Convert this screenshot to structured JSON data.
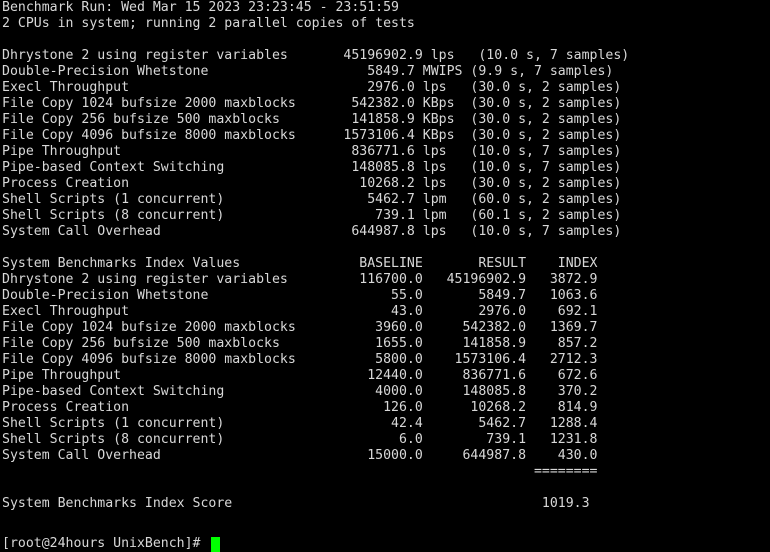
{
  "header": {
    "run": "Benchmark Run: Wed Mar 15 2023 23:23:45 - 23:51:59",
    "cpus": "2 CPUs in system; running 2 parallel copies of tests"
  },
  "results": [
    "Dhrystone 2 using register variables       45196902.9 lps   (10.0 s, 7 samples)",
    "Double-Precision Whetstone                    5849.7 MWIPS (9.9 s, 7 samples)",
    "Execl Throughput                              2976.0 lps   (30.0 s, 2 samples)",
    "File Copy 1024 bufsize 2000 maxblocks       542382.0 KBps  (30.0 s, 2 samples)",
    "File Copy 256 bufsize 500 maxblocks         141858.9 KBps  (30.0 s, 2 samples)",
    "File Copy 4096 bufsize 8000 maxblocks      1573106.4 KBps  (30.0 s, 2 samples)",
    "Pipe Throughput                             836771.6 lps   (10.0 s, 7 samples)",
    "Pipe-based Context Switching                148085.8 lps   (10.0 s, 7 samples)",
    "Process Creation                             10268.2 lps   (30.0 s, 2 samples)",
    "Shell Scripts (1 concurrent)                  5462.7 lpm   (60.0 s, 2 samples)",
    "Shell Scripts (8 concurrent)                   739.1 lpm   (60.1 s, 2 samples)",
    "System Call Overhead                        644987.8 lps   (10.0 s, 7 samples)"
  ],
  "index_header": "System Benchmarks Index Values               BASELINE       RESULT    INDEX",
  "index_rows": [
    "Dhrystone 2 using register variables         116700.0   45196902.9   3872.9",
    "Double-Precision Whetstone                       55.0       5849.7   1063.6",
    "Execl Throughput                                 43.0       2976.0    692.1",
    "File Copy 1024 bufsize 2000 maxblocks          3960.0     542382.0   1369.7",
    "File Copy 256 bufsize 500 maxblocks            1655.0     141858.9    857.2",
    "File Copy 4096 bufsize 8000 maxblocks          5800.0    1573106.4   2712.3",
    "Pipe Throughput                               12440.0     836771.6    672.6",
    "Pipe-based Context Switching                   4000.0     148085.8    370.2",
    "Process Creation                                126.0      10268.2    814.9",
    "Shell Scripts (1 concurrent)                     42.4       5462.7   1288.4",
    "Shell Scripts (8 concurrent)                      6.0        739.1   1231.8",
    "System Call Overhead                          15000.0     644987.8    430.0"
  ],
  "separator": "                                                                   ========",
  "score": "System Benchmarks Index Score                                       1019.3",
  "prompt": "[root@24hours UnixBench]# ",
  "colors": {
    "background": "#000000",
    "text": "#d8d8d8",
    "cursor": "#00ff00"
  }
}
